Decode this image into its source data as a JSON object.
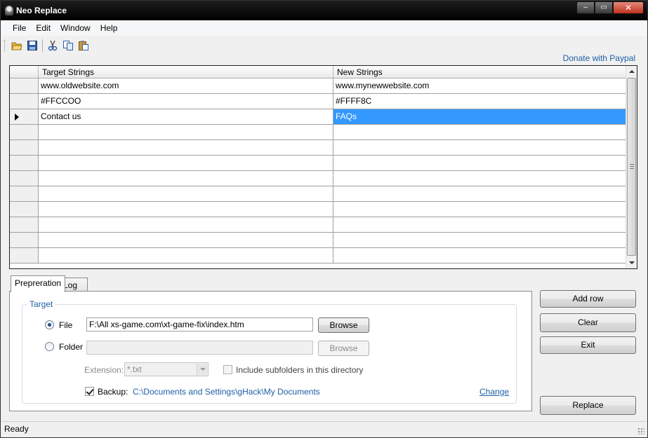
{
  "window": {
    "title": "Neo Replace"
  },
  "menu": [
    "File",
    "Edit",
    "Window",
    "Help"
  ],
  "toolbar": {
    "icons": [
      "open-folder-icon",
      "save-icon",
      "cut-icon",
      "copy-icon",
      "paste-icon"
    ]
  },
  "donate_link": "Donate with Paypal",
  "grid": {
    "columns": [
      "Target Strings",
      "New Strings"
    ],
    "rows": [
      {
        "target": "www.oldwebsite.com",
        "new": "www.mynewwebsite.com"
      },
      {
        "target": "#FFCCOO",
        "new": "#FFFF8C"
      },
      {
        "target": "Contact us",
        "new": "FAQs"
      },
      {
        "target": "",
        "new": ""
      },
      {
        "target": "",
        "new": ""
      },
      {
        "target": "",
        "new": ""
      },
      {
        "target": "",
        "new": ""
      },
      {
        "target": "",
        "new": ""
      },
      {
        "target": "",
        "new": ""
      },
      {
        "target": "",
        "new": ""
      },
      {
        "target": "",
        "new": ""
      },
      {
        "target": "",
        "new": ""
      }
    ],
    "current_row": 3
  },
  "tabs": [
    "Prepreration",
    "Log"
  ],
  "target_group": {
    "legend": "Target",
    "file_label": "File",
    "file_value": "F:\\All xs-game.com\\xt-game-fix\\index.htm",
    "file_selected": true,
    "browse_label": "Browse",
    "folder_label": "Folder",
    "folder_value": "",
    "folder_browse_label": "Browse",
    "extension_label": "Extension:",
    "extension_value": "*.txt",
    "include_subfolders_label": "Include subfolders in this directory",
    "backup_label": "Backup:",
    "backup_checked": true,
    "backup_path": "C:\\Documents and Settings\\gHack\\My Documents",
    "change_link": "Change"
  },
  "side_buttons": {
    "add_row": "Add row",
    "clear": "Clear",
    "exit": "Exit",
    "replace": "Replace"
  },
  "status": "Ready"
}
